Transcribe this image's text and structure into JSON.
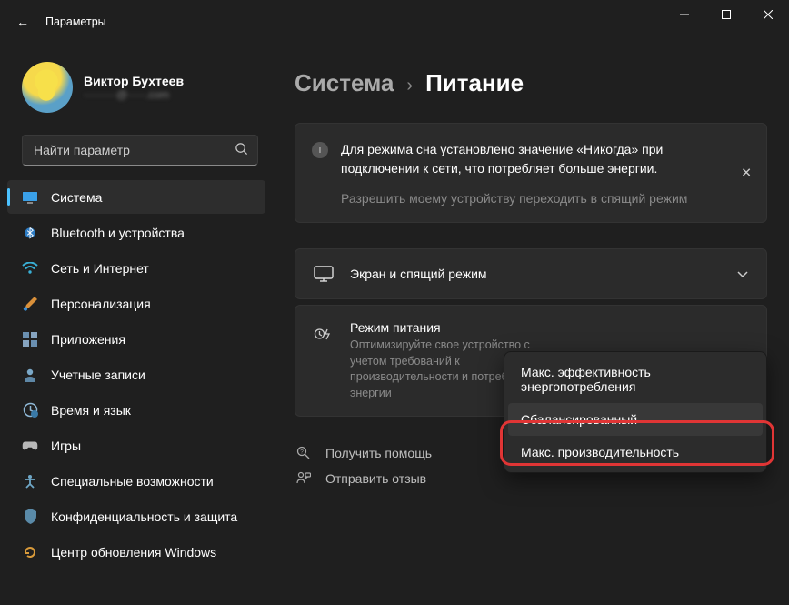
{
  "window": {
    "title": "Параметры"
  },
  "profile": {
    "name": "Виктор Бухтеев",
    "email": "·········@·····.com"
  },
  "search": {
    "placeholder": "Найти параметр"
  },
  "sidebar": {
    "items": [
      {
        "label": "Система"
      },
      {
        "label": "Bluetooth и устройства"
      },
      {
        "label": "Сеть и Интернет"
      },
      {
        "label": "Персонализация"
      },
      {
        "label": "Приложения"
      },
      {
        "label": "Учетные записи"
      },
      {
        "label": "Время и язык"
      },
      {
        "label": "Игры"
      },
      {
        "label": "Специальные возможности"
      },
      {
        "label": "Конфиденциальность и защита"
      },
      {
        "label": "Центр обновления Windows"
      }
    ]
  },
  "breadcrumb": {
    "parent": "Система",
    "current": "Питание"
  },
  "info": {
    "text": "Для режима сна установлено значение «Никогда» при подключении к сети, что потребляет больше энергии.",
    "link": "Разрешить моему устройству переходить в спящий режим"
  },
  "settings": {
    "screen": {
      "title": "Экран и спящий режим"
    },
    "power": {
      "title": "Режим питания",
      "desc": "Оптимизируйте свое устройство с учетом требований к производительности и потреблению энергии"
    }
  },
  "dropdown": {
    "items": [
      {
        "label": "Макс. эффективность энергопотребления"
      },
      {
        "label": "Сбалансированный"
      },
      {
        "label": "Макс. производительность"
      }
    ]
  },
  "footer": {
    "help": "Получить помощь",
    "feedback": "Отправить отзыв"
  }
}
